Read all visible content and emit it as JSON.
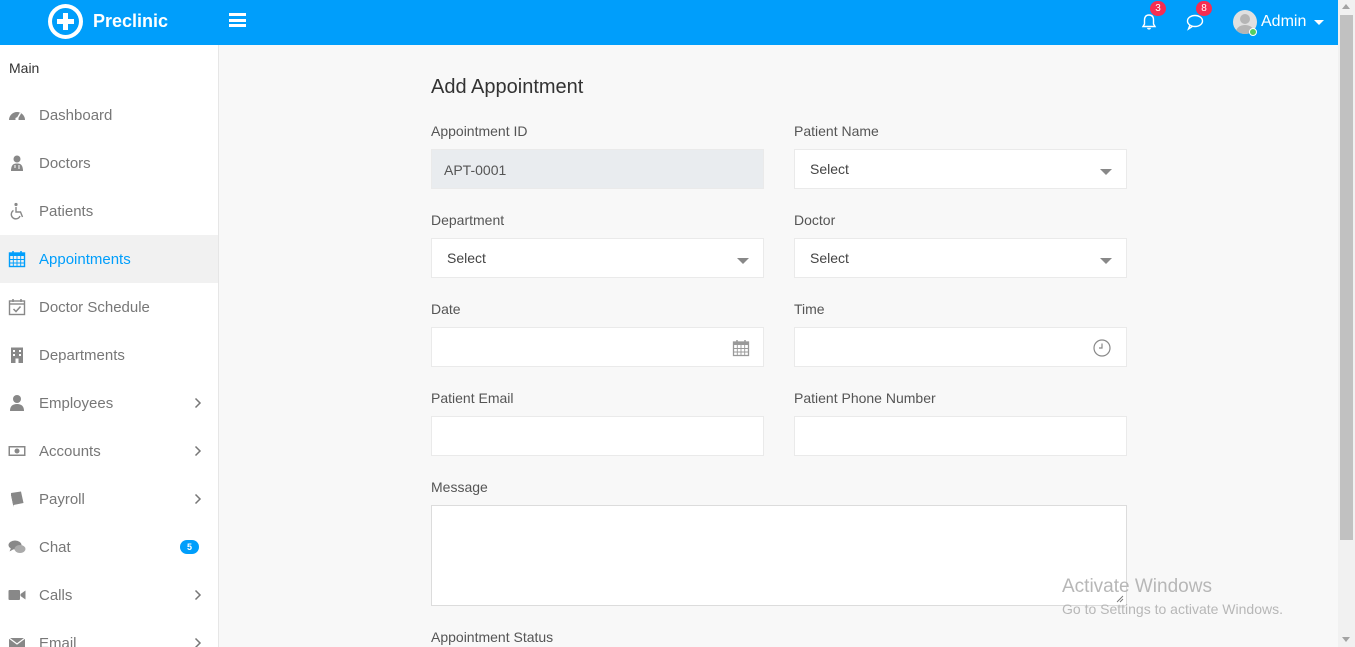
{
  "app": {
    "brand": "Preclinic"
  },
  "header": {
    "notifications_count": "3",
    "messages_count": "8",
    "user_name": "Admin"
  },
  "sidebar": {
    "section_title": "Main",
    "items": [
      {
        "label": "Dashboard",
        "icon": "dashboard-icon"
      },
      {
        "label": "Doctors",
        "icon": "doctor-icon"
      },
      {
        "label": "Patients",
        "icon": "wheelchair-icon"
      },
      {
        "label": "Appointments",
        "icon": "calendar-icon",
        "active": true
      },
      {
        "label": "Doctor Schedule",
        "icon": "calendar-check-icon"
      },
      {
        "label": "Departments",
        "icon": "hospital-icon"
      },
      {
        "label": "Employees",
        "icon": "user-icon",
        "has_submenu": true
      },
      {
        "label": "Accounts",
        "icon": "money-icon",
        "has_submenu": true
      },
      {
        "label": "Payroll",
        "icon": "book-icon",
        "has_submenu": true
      },
      {
        "label": "Chat",
        "icon": "comments-icon",
        "badge": "5"
      },
      {
        "label": "Calls",
        "icon": "video-camera-icon",
        "has_submenu": true
      },
      {
        "label": "Email",
        "icon": "envelope-icon",
        "has_submenu": true
      }
    ]
  },
  "form": {
    "title": "Add Appointment",
    "appointment_id_label": "Appointment ID",
    "appointment_id_value": "APT-0001",
    "patient_name_label": "Patient Name",
    "patient_name_value": "Select",
    "department_label": "Department",
    "department_value": "Select",
    "doctor_label": "Doctor",
    "doctor_value": "Select",
    "date_label": "Date",
    "time_label": "Time",
    "email_label": "Patient Email",
    "phone_label": "Patient Phone Number",
    "message_label": "Message",
    "status_label": "Appointment Status"
  },
  "watermark": {
    "line1": "Activate Windows",
    "line2": "Go to Settings to activate Windows."
  },
  "colors": {
    "primary": "#009efb",
    "badge_red": "#f62d51",
    "online_green": "#55ce63"
  }
}
